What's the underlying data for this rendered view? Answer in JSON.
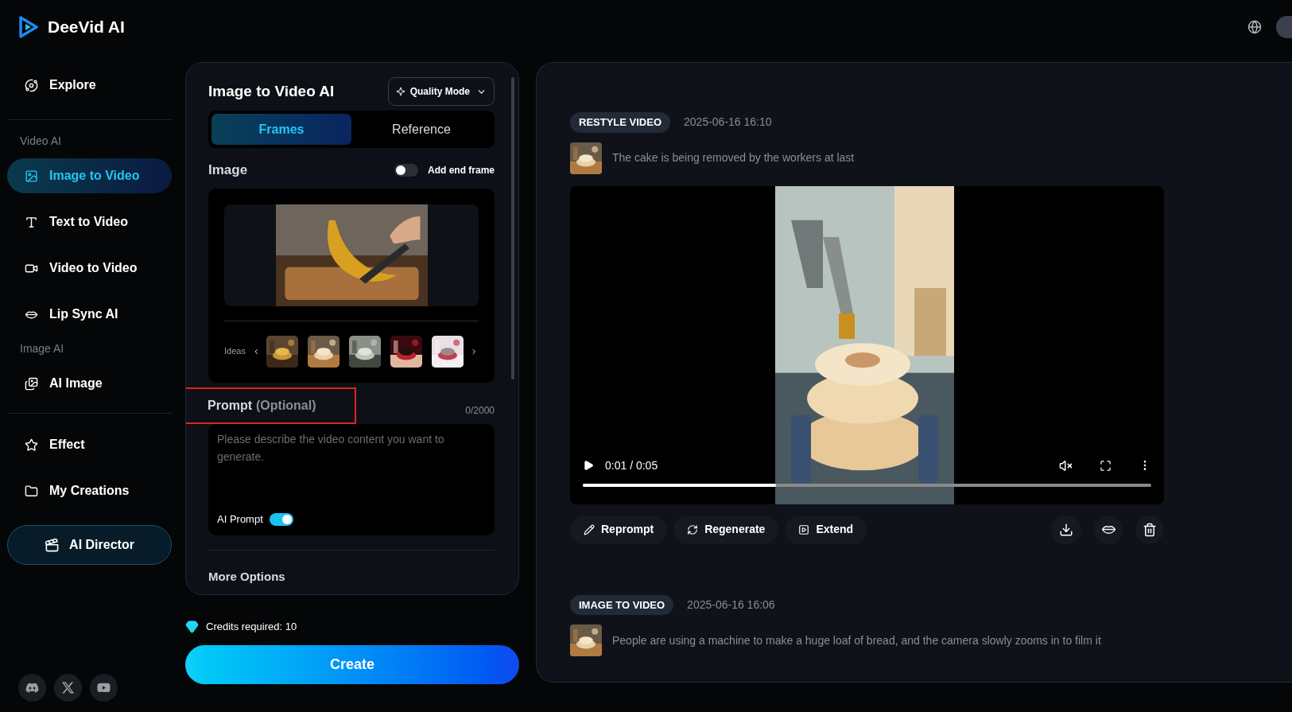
{
  "header": {
    "logo": "DeeVid AI"
  },
  "sidebar": {
    "sections": [
      {
        "items": [
          {
            "label": "Explore",
            "selected": false
          }
        ]
      },
      {
        "heading": "Video AI",
        "items": [
          {
            "label": "Image to Video",
            "selected": true
          },
          {
            "label": "Text to Video",
            "selected": false
          },
          {
            "label": "Video to Video",
            "selected": false
          },
          {
            "label": "Lip Sync AI",
            "selected": false
          }
        ]
      },
      {
        "heading": "Image AI",
        "items": [
          {
            "label": "AI Image",
            "selected": false
          }
        ]
      },
      {
        "items": [
          {
            "label": "Effect",
            "selected": false
          },
          {
            "label": "My Creations",
            "selected": false
          }
        ]
      }
    ],
    "director_button": "AI Director"
  },
  "form": {
    "title": "Image to Video AI",
    "mode_button": "Quality Mode",
    "tabs": [
      {
        "label": "Frames",
        "selected": true
      },
      {
        "label": "Reference",
        "selected": false
      }
    ],
    "image": {
      "label": "Image",
      "end_frame_toggle": {
        "label": "Add end frame",
        "on": false
      },
      "ideas_label": "Ideas"
    },
    "prompt": {
      "label": "Prompt",
      "note": "(Optional)",
      "counter": "0/2000",
      "placeholder": "Please describe the video content you want to generate.",
      "ai_prompt_toggle": {
        "label": "AI Prompt",
        "on": true
      }
    },
    "more_options": "More Options"
  },
  "credits": "Credits required: 10",
  "create_button": "Create",
  "feed": [
    {
      "badge": "RESTYLE VIDEO",
      "time": "2025-06-16 16:10",
      "prompt": "The cake is being removed by the workers at last",
      "video": {
        "time": "0:01 / 0:05",
        "level": 0.34,
        "muted": true
      },
      "actions": [
        "Reprompt",
        "Regenerate",
        "Extend"
      ]
    },
    {
      "badge": "IMAGE TO VIDEO",
      "time": "2025-06-16 16:06",
      "prompt": "People are using a machine to make a huge loaf of bread, and the camera slowly zooms in to film it"
    }
  ]
}
